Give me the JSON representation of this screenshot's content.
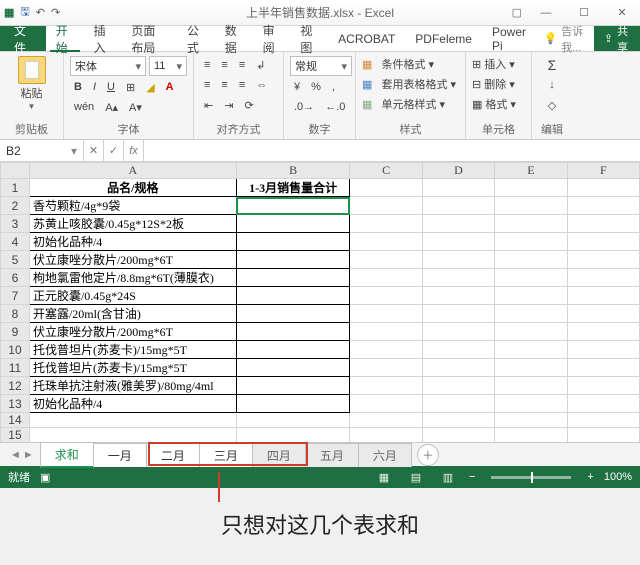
{
  "title": "上半年销售数据.xlsx - Excel",
  "tabs": {
    "file": "文件",
    "home": "开始",
    "insert": "插入",
    "layout": "页面布局",
    "formulas": "公式",
    "data": "数据",
    "review": "审阅",
    "view": "视图",
    "acrobat": "ACROBAT",
    "pdfelem": "PDFeleme",
    "powerpi": "Power Pi"
  },
  "tell_me": "告诉我...",
  "share": "共享",
  "ribbon": {
    "paste_label": "粘贴",
    "clipboard_label": "剪贴板",
    "font_name": "宋体",
    "font_size": "11",
    "font_label": "字体",
    "align_label": "对齐方式",
    "number_format": "常规",
    "number_label": "数字",
    "cond_format": "条件格式",
    "table_format": "套用表格格式",
    "cell_style": "单元格样式",
    "styles_label": "样式",
    "insert_btn": "插入",
    "delete_btn": "删除",
    "format_btn": "格式",
    "cells_label": "单元格",
    "editing_label": "编辑"
  },
  "namebox": "B2",
  "formula": "",
  "columns": [
    "A",
    "B",
    "C",
    "D",
    "E",
    "F"
  ],
  "header": {
    "A": "品名/规格",
    "B": "1-3月销售量合计"
  },
  "rows": [
    "香芍颗粒/4g*9袋",
    "苏黄止咳胶囊/0.45g*12S*2板",
    "初始化品种/4",
    "伏立康唑分散片/200mg*6T",
    "枸地氯雷他定片/8.8mg*6T(薄膜衣)",
    "正元胶囊/0.45g*24S",
    "开塞露/20ml(含甘油)",
    "伏立康唑分散片/200mg*6T",
    "托伐普坦片(苏麦卡)/15mg*5T",
    "托伐普坦片(苏麦卡)/15mg*5T",
    "托珠单抗注射液(雅美罗)/80mg/4ml",
    "初始化品种/4"
  ],
  "sheets": {
    "sum": "求和",
    "jan": "一月",
    "feb": "二月",
    "mar": "三月",
    "apr": "四月",
    "may": "五月",
    "jun": "六月"
  },
  "status": {
    "ready": "就绪",
    "zoom": "100%"
  },
  "caption": "只想对这几个表求和"
}
